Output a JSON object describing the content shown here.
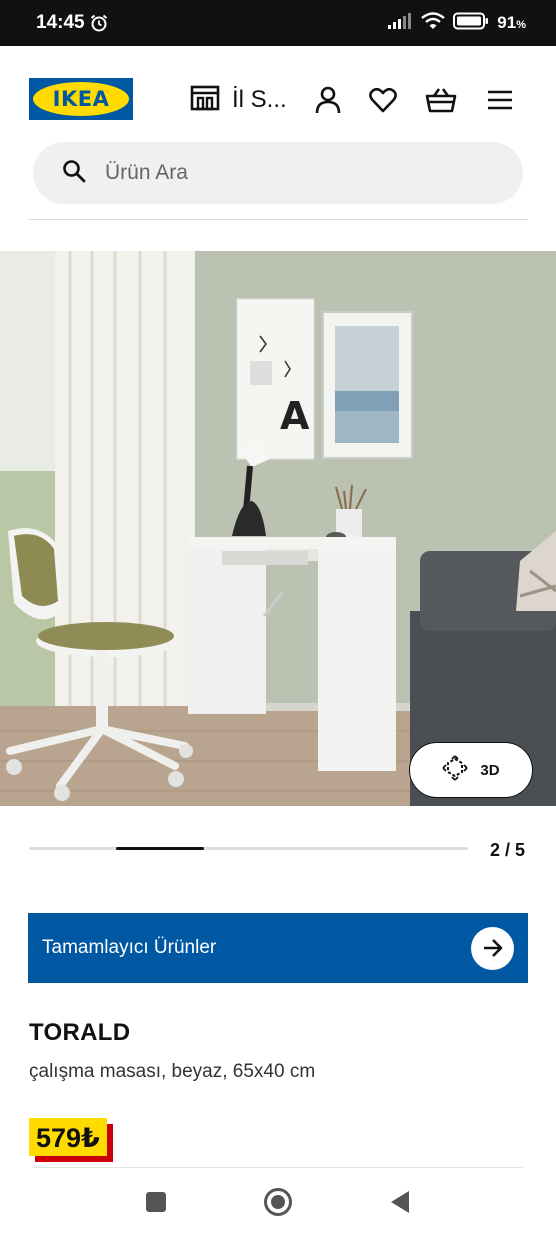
{
  "status_bar": {
    "time": "14:45",
    "battery_percent": "91",
    "battery_unit": "%"
  },
  "header": {
    "logo_text": "IKEA",
    "store_label": "İl S...",
    "icons": [
      "store-icon",
      "user-icon",
      "heart-icon",
      "basket-icon",
      "menu-icon"
    ]
  },
  "search": {
    "placeholder": "Ürün Ara"
  },
  "gallery": {
    "counter": "2 / 5",
    "current": 2,
    "total": 5,
    "button_3d_label": "3D"
  },
  "complementary": {
    "label": "Tamamlayıcı Ürünler"
  },
  "product": {
    "name": "TORALD",
    "description": "çalışma masası, beyaz, 65x40 cm",
    "price": "579₺"
  },
  "colors": {
    "ikea_blue": "#0058a3",
    "ikea_yellow": "#ffdb00",
    "price_red": "#cc0008"
  }
}
